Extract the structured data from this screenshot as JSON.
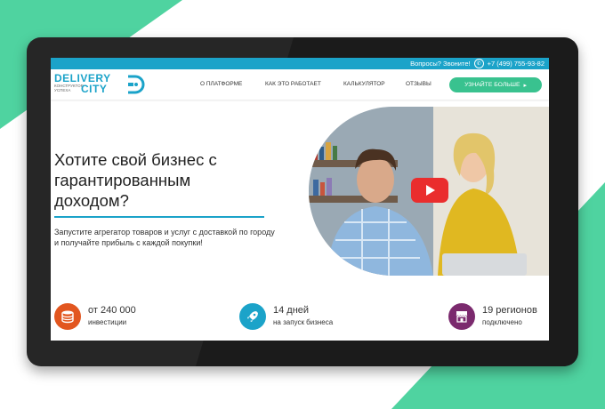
{
  "topbar": {
    "question": "Вопросы? Звоните!",
    "phone": "+7 (499) 755-93-82",
    "phone_icon": "phone-icon"
  },
  "logo": {
    "word1": "DELIVERY",
    "subtitle_line1": "конструктор",
    "subtitle_line2": "успеха",
    "word2": "CITY"
  },
  "nav": {
    "items": [
      {
        "label": "О платформе"
      },
      {
        "label": "Как это работает"
      },
      {
        "label": "Калькулятор"
      },
      {
        "label": "Отзывы"
      }
    ],
    "cta_label": "Узнайте больше",
    "cta_arrow": "▸"
  },
  "hero": {
    "title": "Хотите свой бизнес с гарантированным доходом?",
    "subtitle": "Запустите агрегатор товаров и услуг с доставкой по городу и получайте прибыль с каждой покупки!"
  },
  "stats": [
    {
      "value": "от 240 000",
      "label": "инвестиции",
      "icon": "coins-icon",
      "color": "#e2561f"
    },
    {
      "value": "14 дней",
      "label": "на запуск бизнеса",
      "icon": "rocket-icon",
      "color": "#1ba3c9"
    },
    {
      "value": "19 регионов",
      "label": "подключено",
      "icon": "storefront-icon",
      "color": "#7b2a6e"
    }
  ],
  "colors": {
    "accent": "#1ba3c9",
    "cta": "#39c28f",
    "deco_green": "#4fd3a0",
    "play": "#ea2d2d"
  }
}
